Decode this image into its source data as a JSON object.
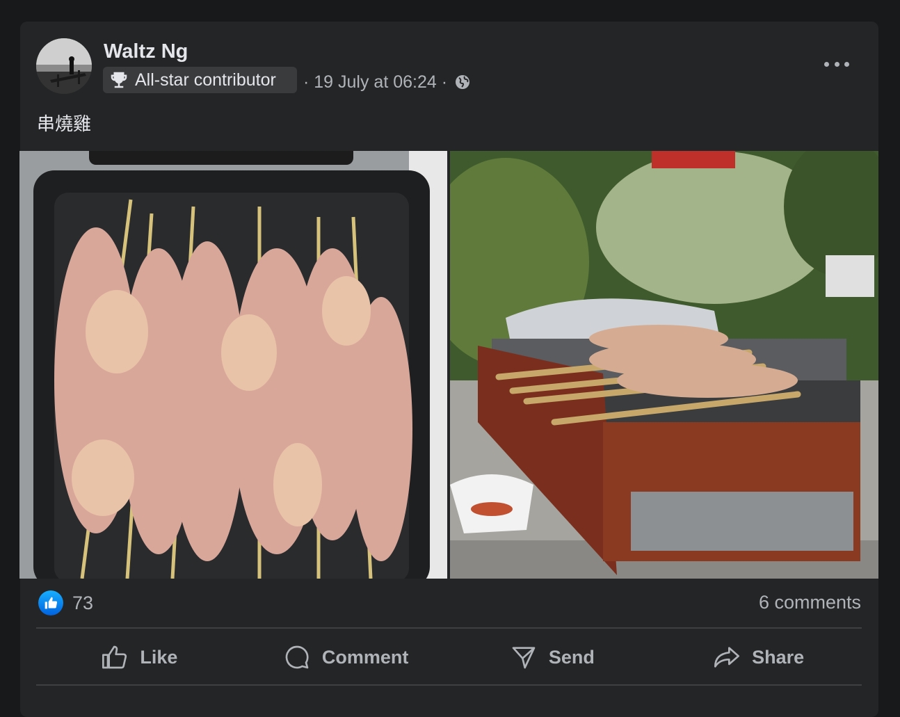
{
  "post": {
    "author": "Waltz Ng",
    "badge": "All-star contributor",
    "timestamp": "· 19 July at 06:24 ·",
    "text": "串燒雞"
  },
  "icons": {
    "badge": "trophy-icon",
    "privacy": "globe-icon",
    "more": "more-options-icon"
  },
  "photos": [
    {
      "subject": "raw chicken skewers in black tray"
    },
    {
      "subject": "chicken skewers on tabletop grill in garden"
    }
  ],
  "stats": {
    "likes": "73",
    "comments": "6 comments"
  },
  "actions": {
    "like": "Like",
    "comment": "Comment",
    "send": "Send",
    "share": "Share"
  },
  "colors": {
    "background": "#18191a",
    "card": "#242526",
    "text_primary": "#e4e6eb",
    "text_secondary": "#b0b3b8",
    "like_blue": "#0866ff"
  }
}
